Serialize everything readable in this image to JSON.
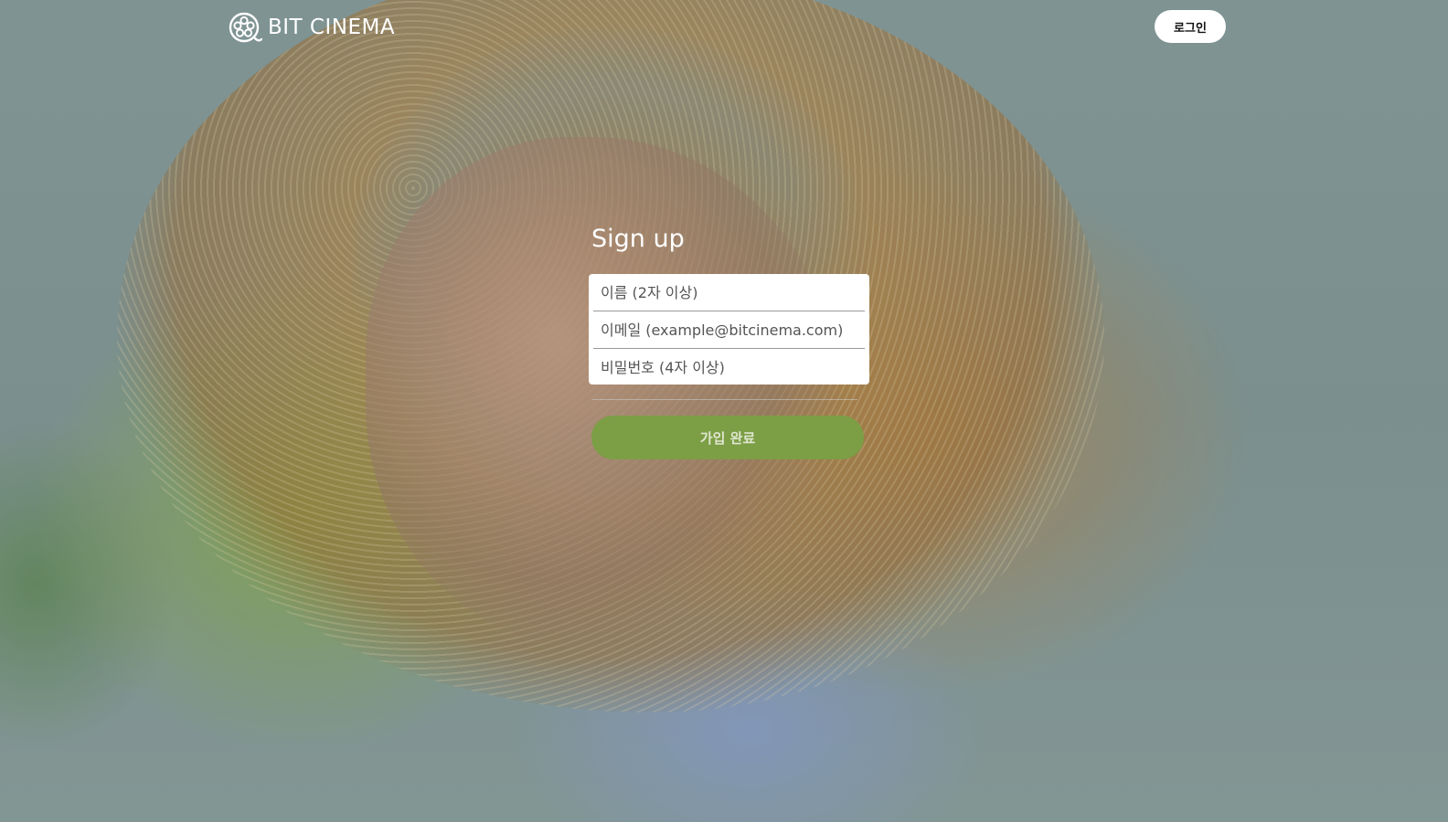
{
  "header": {
    "brand": "BIT CINEMA",
    "logo_icon": "film-reel-icon",
    "login_label": "로그인"
  },
  "signup": {
    "title": "Sign up",
    "name_placeholder": "이름 (2자 이상)",
    "email_placeholder": "이메일 (example@bitcinema.com)",
    "password_placeholder": "비밀번호 (4자 이상)",
    "submit_label": "가입 완료"
  },
  "colors": {
    "accent": "#7c9e45",
    "text_on_dark": "#ffffff"
  }
}
